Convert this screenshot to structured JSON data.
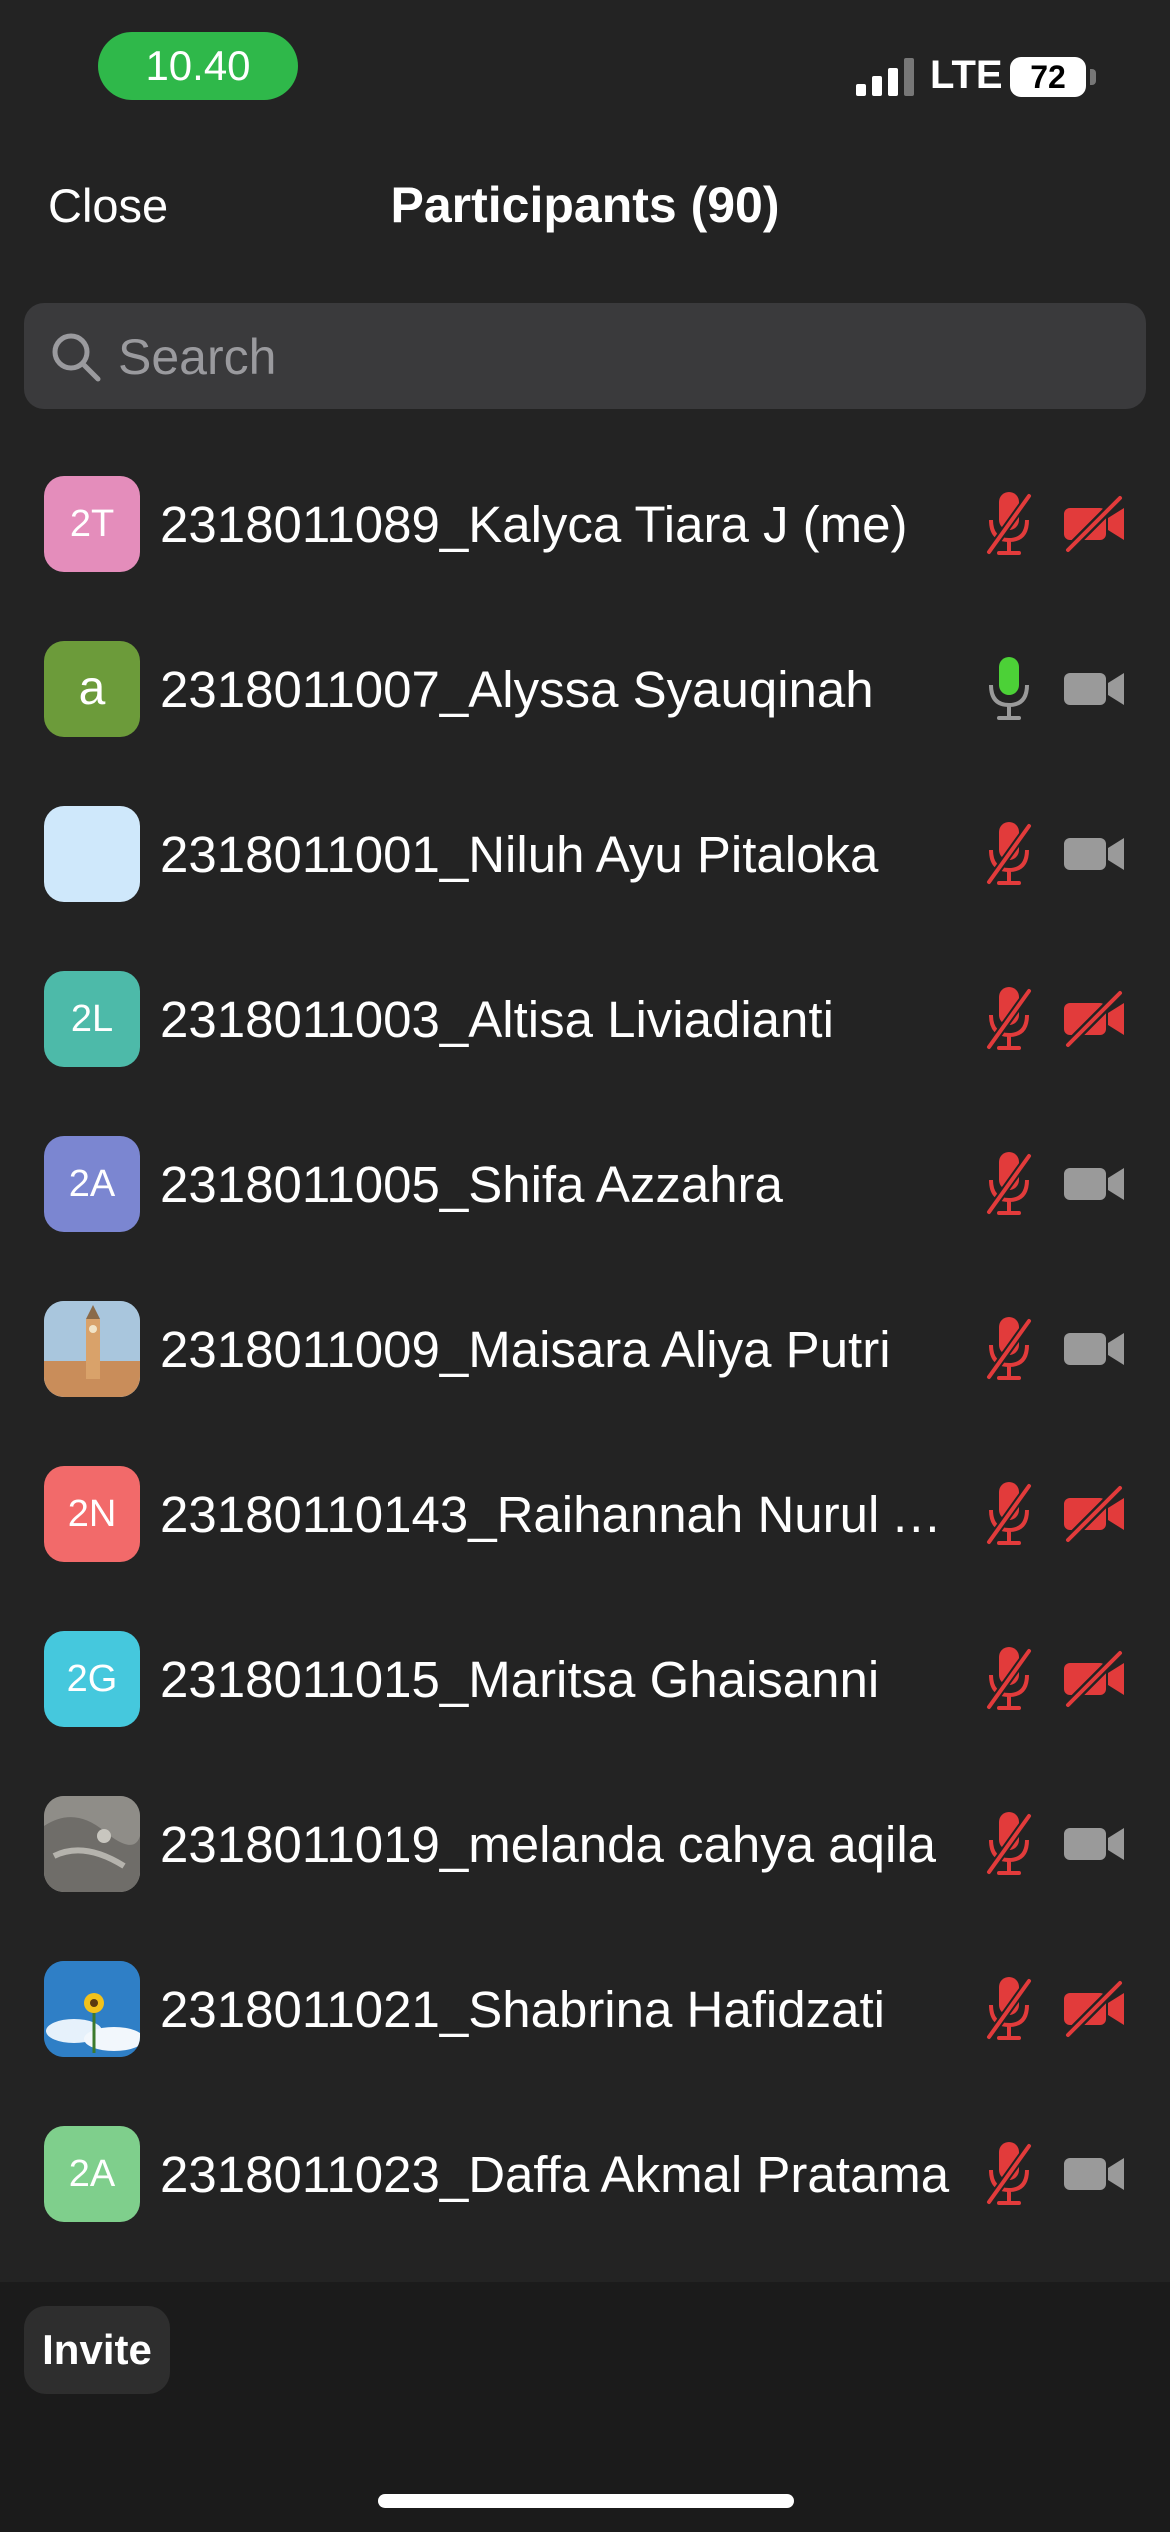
{
  "status_bar": {
    "time": "10.40",
    "network": "LTE",
    "battery": "72"
  },
  "header": {
    "close_label": "Close",
    "title": "Participants (90)"
  },
  "search": {
    "placeholder": "Search",
    "value": ""
  },
  "participants": [
    {
      "name": "2318011089_Kalyca Tiara J (me)",
      "avatar_text": "2T",
      "avatar_color": "#e48dbb",
      "avatar_kind": "initials",
      "mic": "muted",
      "video": "off"
    },
    {
      "name": "2318011007_Alyssa Syauqinah",
      "avatar_text": "a",
      "avatar_color": "#6c9b3a",
      "avatar_kind": "initials",
      "mic": "active",
      "video": "on"
    },
    {
      "name": "2318011001_Niluh Ayu Pitaloka",
      "avatar_text": "",
      "avatar_color": "#cfe8fb",
      "avatar_kind": "blank",
      "mic": "muted",
      "video": "on"
    },
    {
      "name": "2318011003_Altisa Liviadianti",
      "avatar_text": "2L",
      "avatar_color": "#4dbaa9",
      "avatar_kind": "initials",
      "mic": "muted",
      "video": "off"
    },
    {
      "name": "2318011005_Shifa Azzahra",
      "avatar_text": "2A",
      "avatar_color": "#7b86d1",
      "avatar_kind": "initials",
      "mic": "muted",
      "video": "on"
    },
    {
      "name": "2318011009_Maisara Aliya Putri",
      "avatar_text": "",
      "avatar_color": "#9ab8d0",
      "avatar_kind": "photo-big-ben",
      "mic": "muted",
      "video": "on"
    },
    {
      "name": "23180110143_Raihannah Nurul A...",
      "avatar_text": "2N",
      "avatar_color": "#f26a6a",
      "avatar_kind": "initials",
      "mic": "muted",
      "video": "off"
    },
    {
      "name": "2318011015_Maritsa Ghaisanni",
      "avatar_text": "2G",
      "avatar_color": "#45c8dd",
      "avatar_kind": "initials",
      "mic": "muted",
      "video": "off"
    },
    {
      "name": "2318011019_melanda cahya aqila",
      "avatar_text": "",
      "avatar_color": "#8a8a85",
      "avatar_kind": "photo-fabric",
      "mic": "muted",
      "video": "on"
    },
    {
      "name": "2318011021_Shabrina Hafidzati",
      "avatar_text": "",
      "avatar_color": "#2d7ac0",
      "avatar_kind": "photo-sunflower",
      "mic": "muted",
      "video": "off"
    },
    {
      "name": "2318011023_Daffa Akmal Pratama",
      "avatar_text": "2A",
      "avatar_color": "#7fcf8c",
      "avatar_kind": "initials",
      "mic": "muted",
      "video": "on"
    }
  ],
  "footer": {
    "invite_label": "Invite"
  },
  "colors": {
    "muted_red": "#e23b3b",
    "active_green": "#4cd137",
    "video_gray": "#9a9a9a",
    "background": "#232323"
  },
  "icons": {
    "search": "search-icon",
    "mic_muted": "mic-muted-icon",
    "mic_active": "mic-active-icon",
    "video_on": "video-icon",
    "video_off": "video-off-icon"
  }
}
